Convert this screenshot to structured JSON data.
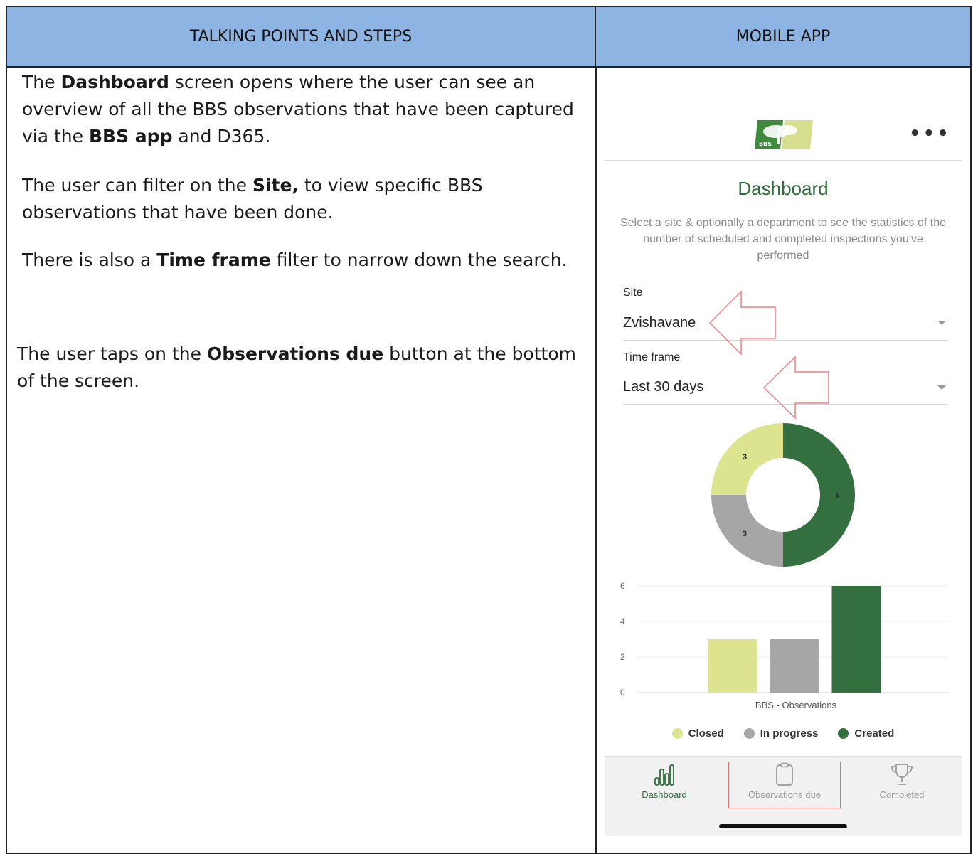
{
  "table": {
    "col_left_header": "TALKING POINTS AND STEPS",
    "col_right_header": "MOBILE APP"
  },
  "talking_points": {
    "p1": {
      "a": "The ",
      "b": "Dashboard",
      "c": " screen opens where the user can see an overview of all the BBS observations that have been captured via the ",
      "d": "BBS app",
      "e": " and D365."
    },
    "p2": {
      "a": "The user can filter on the ",
      "b": "Site,",
      "c": " to view specific BBS observations that have been done."
    },
    "p3": {
      "a": "There is also a ",
      "b": "Time frame",
      "c": " filter to narrow down the search."
    },
    "p4": {
      "a": "The user taps on the ",
      "b": "Observations due",
      "c": " button at the bottom of the screen."
    }
  },
  "app": {
    "logo_text": "BBS",
    "more_icon": "more-dots-icon",
    "title": "Dashboard",
    "subtitle": "Select a site & optionally a department to see the statistics of the number of scheduled and completed inspections you've performed",
    "site": {
      "label": "Site",
      "value": "Zvishavane"
    },
    "timeframe": {
      "label": "Time frame",
      "value": "Last 30 days"
    },
    "tabs": [
      {
        "label": "Dashboard",
        "icon": "bar-chart-icon",
        "active": true
      },
      {
        "label": "Observations due",
        "icon": "clipboard-icon",
        "active": false
      },
      {
        "label": "Completed",
        "icon": "trophy-icon",
        "active": false
      }
    ],
    "colors": {
      "closed": "#dde48f",
      "in_progress": "#a6a6a6",
      "created": "#336f3f",
      "accent": "#2e6b3a"
    }
  },
  "chart_data": [
    {
      "type": "pie",
      "categories": [
        "Closed",
        "In progress",
        "Created"
      ],
      "values": [
        3,
        3,
        6
      ],
      "labels": [
        "3",
        "3",
        "6"
      ]
    },
    {
      "type": "bar",
      "categories": [
        "BBS - Observations"
      ],
      "series": [
        {
          "name": "Closed",
          "values": [
            3
          ]
        },
        {
          "name": "In progress",
          "values": [
            3
          ]
        },
        {
          "name": "Created",
          "values": [
            6
          ]
        }
      ],
      "xlabel": "BBS - Observations",
      "ylim": [
        0,
        6
      ],
      "yticks": [
        "0",
        "2",
        "4",
        "6"
      ],
      "grid": true,
      "legend": [
        "Closed",
        "In progress",
        "Created"
      ],
      "legend_position": "bottom"
    }
  ]
}
